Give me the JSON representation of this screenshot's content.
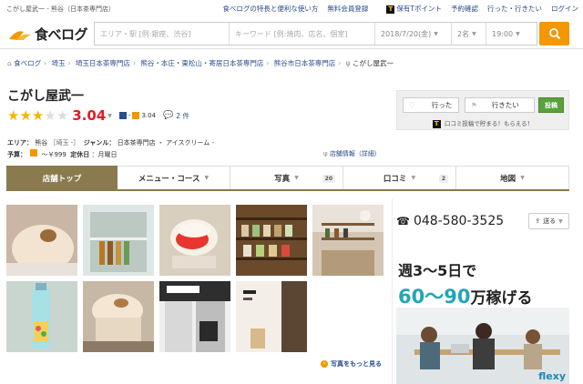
{
  "topbar": {
    "page_caption": "こがし屋武一 - 熊谷（日本茶専門店）",
    "links": [
      "食べログの特長と便利な使い方",
      "無料会員登録",
      "保有Tポイント",
      "予約確認",
      "行った・行きたい",
      "ログイン"
    ]
  },
  "header": {
    "logo_text": "食べログ",
    "search": {
      "area_placeholder": "エリア・駅 [例:銀座、渋谷]",
      "keyword_placeholder": "キーワード [例:焼肉、店名、個室]",
      "date": "2018/7/20(金)",
      "people": "2名",
      "time": "19:00"
    }
  },
  "breadcrumb": [
    "食べログ",
    "埼玉",
    "埼玉日本茶専門店",
    "熊谷・本庄・東松山・寄居日本茶専門店",
    "熊谷市日本茶専門店",
    "こがし屋武一"
  ],
  "restaurant": {
    "name": "こがし屋武一",
    "rating": 3.04,
    "rating_text": "3.04",
    "sub_rating": "3.04",
    "review_count": "2 件",
    "area_label": "エリア：",
    "area": "熊谷",
    "area_tag": "［埼玉 -］",
    "genre_label": "ジャンル：",
    "genre": "日本茶専門店 ・ アイスクリーム -",
    "budget_label": "予算：",
    "budget": "～￥999",
    "closed_label": "定休日",
    "closed": "：月曜日",
    "info_link": "店舗情報（詳細）"
  },
  "actions": {
    "went": "行った",
    "want": "行きたい",
    "post": "投稿",
    "note": "口コミ投稿で貯まる！もらえる！"
  },
  "tabs": [
    {
      "label": "店舗トップ",
      "count": ""
    },
    {
      "label": "メニュー・コース",
      "count": ""
    },
    {
      "label": "写真",
      "count": "20"
    },
    {
      "label": "口コミ",
      "count": "2"
    },
    {
      "label": "地図",
      "count": ""
    }
  ],
  "photos_link": "写真をもっと見る",
  "phone": "048-580-3525",
  "share": "送る",
  "ad": {
    "line1": "週3〜5日で",
    "line2_num": "60〜90",
    "line2_unit": "万",
    "line2_rest": "稼げる",
    "brand": "flexy"
  },
  "colors": {
    "accent": "#f39800",
    "tab_active": "#8a7a4d",
    "score": "#e31b23",
    "link": "#2a4b8d"
  }
}
